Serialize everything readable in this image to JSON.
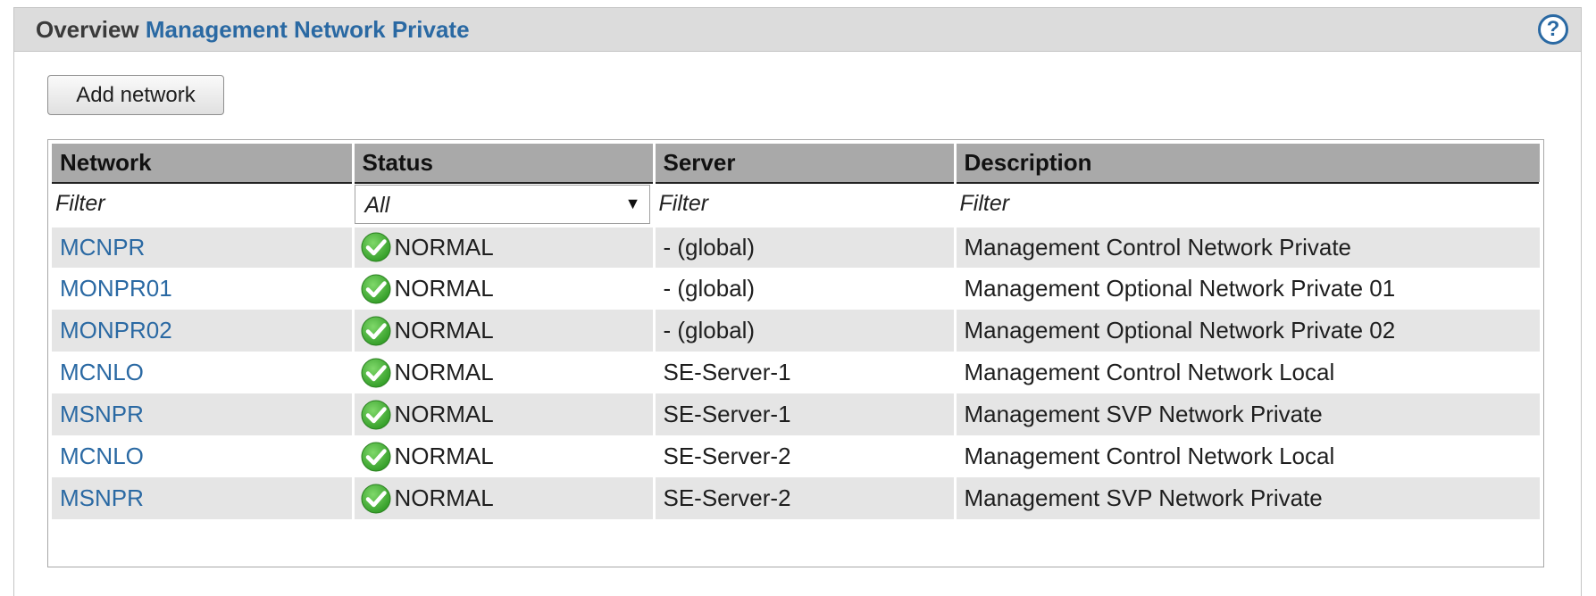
{
  "header": {
    "title_prefix": "Overview",
    "title_accent": "Management Network Private",
    "help_label": "?"
  },
  "toolbar": {
    "add_label": "Add network"
  },
  "table": {
    "columns": [
      "Network",
      "Status",
      "Server",
      "Description"
    ],
    "filters": {
      "network_placeholder": "Filter",
      "status_selected": "All",
      "status_arrow": "▼",
      "server_placeholder": "Filter",
      "description_placeholder": "Filter"
    },
    "rows": [
      {
        "network": "MCNPR",
        "status": "NORMAL",
        "server": "- (global)",
        "description": "Management Control Network Private"
      },
      {
        "network": "MONPR01",
        "status": "NORMAL",
        "server": "- (global)",
        "description": "Management Optional Network Private 01"
      },
      {
        "network": "MONPR02",
        "status": "NORMAL",
        "server": "- (global)",
        "description": "Management Optional Network Private 02"
      },
      {
        "network": "MCNLO",
        "status": "NORMAL",
        "server": "SE-Server-1",
        "description": "Management Control Network Local"
      },
      {
        "network": "MSNPR",
        "status": "NORMAL",
        "server": "SE-Server-1",
        "description": "Management SVP Network Private"
      },
      {
        "network": "MCNLO",
        "status": "NORMAL",
        "server": "SE-Server-2",
        "description": "Management Control Network Local"
      },
      {
        "network": "MSNPR",
        "status": "NORMAL",
        "server": "SE-Server-2",
        "description": "Management SVP Network Private"
      }
    ]
  },
  "icons": {
    "status_ok": "checkmark-circle-icon"
  },
  "colors": {
    "accent": "#2a69a3",
    "header_bg": "#dcdcdc",
    "column_header_bg": "#a9a9a9",
    "row_stripe": "#e5e5e5",
    "status_ok": "#3aa82d"
  }
}
